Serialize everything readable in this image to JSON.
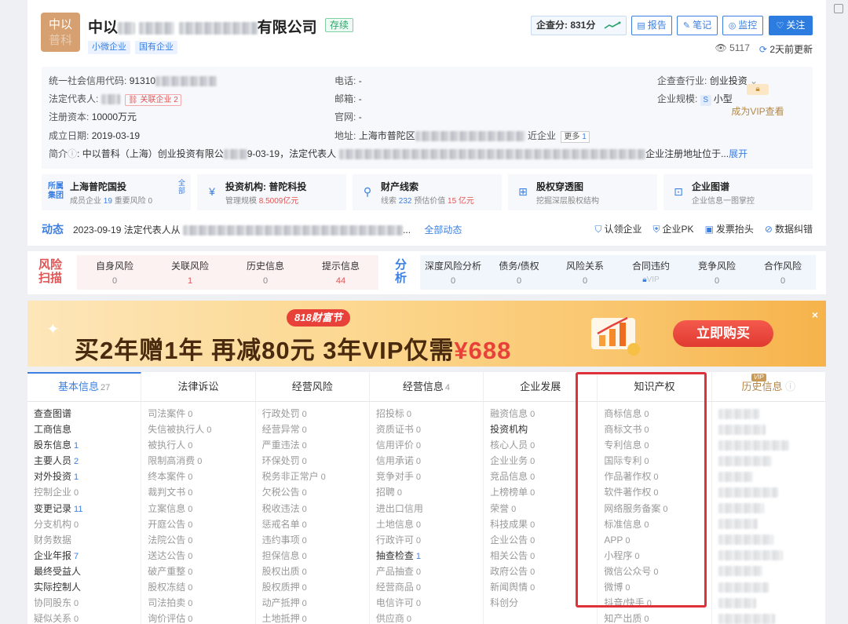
{
  "company": {
    "logo_line1": "中以",
    "logo_line2": "普科",
    "name_prefix": "中以",
    "name_suffix": "有限公司",
    "status": "存续",
    "tags": [
      "小微企业",
      "国有企业"
    ],
    "score_label": "企查分: 831分",
    "buttons": {
      "report": "报告",
      "note": "笔记",
      "monitor": "监控",
      "follow": "关注"
    },
    "views": "5117",
    "updated": "2天前更新"
  },
  "info": {
    "credit_code_label": "统一社会信用代码:",
    "credit_code_value": "91310",
    "legal_rep_label": "法定代表人:",
    "related_label": "关联企业",
    "related_count": "2",
    "capital_label": "注册资本:",
    "capital_value": "10000万元",
    "date_label": "成立日期:",
    "date_value": "2019-03-19",
    "intro_label": "简介",
    "intro_text": ": 中以普科（上海）创业投资有限公",
    "intro_mid": "9-03-19，法定代表人",
    "intro_tail": "企业注册地址位于...",
    "intro_more": "展开",
    "phone_label": "电话:",
    "phone_value": "-",
    "email_label": "邮箱:",
    "email_value": "-",
    "site_label": "官网:",
    "site_value": "-",
    "address_label": "地址:",
    "address_value": "上海市普陀区",
    "nearby": "近企业",
    "more": "更多",
    "more_count": "1",
    "industry_label": "企查查行业:",
    "industry_value": "创业投资",
    "scale_label": "企业规模:",
    "scale_badge": "S",
    "scale_value": "小型"
  },
  "quick_cards": [
    {
      "title": "上海普陀国投",
      "sub1": "成员企业",
      "v1": "19",
      "sub2": "重要风险",
      "v2": "0",
      "mark": "所属集团",
      "all": "全部"
    },
    {
      "title": "投资机构: 普陀科投",
      "sub1": "管理规模",
      "v1": "8.5009亿元"
    },
    {
      "title": "财产线索",
      "sub1": "线索",
      "v1": "232",
      "sub2": "预估价值",
      "v2": "15 亿元"
    },
    {
      "title": "股权穿透图",
      "sub1": "挖掘深层股权结构"
    },
    {
      "title": "企业图谱",
      "sub1": "企业信息一图掌控"
    }
  ],
  "dynamics": {
    "label": "动态",
    "text": "2023-09-19 法定代表人从",
    "ellipsis": "...",
    "all": "全部动态",
    "actions": [
      "认领企业",
      "企业PK",
      "发票抬头",
      "数据纠错"
    ]
  },
  "risk": {
    "mark": "风险扫描",
    "items": [
      {
        "label": "自身风险",
        "value": "0"
      },
      {
        "label": "关联风险",
        "value": "1"
      },
      {
        "label": "历史信息",
        "value": "0"
      },
      {
        "label": "提示信息",
        "value": "44"
      }
    ],
    "analysis_mark": "分析",
    "analysis": [
      {
        "label": "深度风险分析",
        "value": "0"
      },
      {
        "label": "债务/债权",
        "value": "0"
      },
      {
        "label": "风险关系",
        "value": "0"
      },
      {
        "label": "合同违约",
        "value": "VIP"
      },
      {
        "label": "竞争风险",
        "value": "0"
      },
      {
        "label": "合作风险",
        "value": "0"
      }
    ]
  },
  "banner": {
    "badge": "818财富节",
    "headline_a": "买2年赠1年 再减80元 3年VIP仅需",
    "headline_price": "¥688",
    "buy": "立即购买",
    "close": "×"
  },
  "tabs": [
    {
      "label": "基本信息",
      "count": "27"
    },
    {
      "label": "法律诉讼",
      "count": ""
    },
    {
      "label": "经营风险",
      "count": ""
    },
    {
      "label": "经营信息",
      "count": "4"
    },
    {
      "label": "企业发展",
      "count": ""
    },
    {
      "label": "知识产权",
      "count": ""
    },
    {
      "label": "历史信息",
      "count": "",
      "vip": "VIP"
    }
  ],
  "columns": [
    [
      {
        "t": "查查图谱",
        "n": ""
      },
      {
        "t": "工商信息",
        "n": ""
      },
      {
        "t": "股东信息",
        "n": "1",
        "blue": true
      },
      {
        "t": "主要人员",
        "n": "2",
        "blue": true
      },
      {
        "t": "对外投资",
        "n": "1",
        "blue": true
      },
      {
        "t": "控制企业",
        "n": "0",
        "dim": true
      },
      {
        "t": "变更记录",
        "n": "11",
        "blue": true
      },
      {
        "t": "分支机构",
        "n": "0",
        "dim": true
      },
      {
        "t": "财务数据",
        "n": "",
        "dim": true
      },
      {
        "t": "企业年报",
        "n": "7",
        "blue": true
      },
      {
        "t": "最终受益人",
        "n": ""
      },
      {
        "t": "实际控制人",
        "n": ""
      },
      {
        "t": "协同股东",
        "n": "0",
        "dim": true
      },
      {
        "t": "疑似关系",
        "n": "0",
        "dim": true
      }
    ],
    [
      {
        "t": "司法案件",
        "n": "0",
        "dim": true
      },
      {
        "t": "失信被执行人",
        "n": "0",
        "dim": true
      },
      {
        "t": "被执行人",
        "n": "0",
        "dim": true
      },
      {
        "t": "限制高消费",
        "n": "0",
        "dim": true
      },
      {
        "t": "终本案件",
        "n": "0",
        "dim": true
      },
      {
        "t": "裁判文书",
        "n": "0",
        "dim": true
      },
      {
        "t": "立案信息",
        "n": "0",
        "dim": true
      },
      {
        "t": "开庭公告",
        "n": "0",
        "dim": true
      },
      {
        "t": "法院公告",
        "n": "0",
        "dim": true
      },
      {
        "t": "送达公告",
        "n": "0",
        "dim": true
      },
      {
        "t": "破产重整",
        "n": "0",
        "dim": true
      },
      {
        "t": "股权冻结",
        "n": "0",
        "dim": true
      },
      {
        "t": "司法拍卖",
        "n": "0",
        "dim": true
      },
      {
        "t": "询价评估",
        "n": "0",
        "dim": true
      }
    ],
    [
      {
        "t": "行政处罚",
        "n": "0",
        "dim": true
      },
      {
        "t": "经营异常",
        "n": "0",
        "dim": true
      },
      {
        "t": "严重违法",
        "n": "0",
        "dim": true
      },
      {
        "t": "环保处罚",
        "n": "0",
        "dim": true
      },
      {
        "t": "税务非正常户",
        "n": "0",
        "dim": true
      },
      {
        "t": "欠税公告",
        "n": "0",
        "dim": true
      },
      {
        "t": "税收违法",
        "n": "0",
        "dim": true
      },
      {
        "t": "惩戒名单",
        "n": "0",
        "dim": true
      },
      {
        "t": "违约事项",
        "n": "0",
        "dim": true
      },
      {
        "t": "担保信息",
        "n": "0",
        "dim": true
      },
      {
        "t": "股权出质",
        "n": "0",
        "dim": true
      },
      {
        "t": "股权质押",
        "n": "0",
        "dim": true
      },
      {
        "t": "动产抵押",
        "n": "0",
        "dim": true
      },
      {
        "t": "土地抵押",
        "n": "0",
        "dim": true
      }
    ],
    [
      {
        "t": "招投标",
        "n": "0",
        "dim": true
      },
      {
        "t": "资质证书",
        "n": "0",
        "dim": true
      },
      {
        "t": "信用评价",
        "n": "0",
        "dim": true
      },
      {
        "t": "信用承诺",
        "n": "0",
        "dim": true
      },
      {
        "t": "竞争对手",
        "n": "0",
        "dim": true
      },
      {
        "t": "招聘",
        "n": "0",
        "dim": true
      },
      {
        "t": "进出口信用",
        "n": "",
        "dim": true
      },
      {
        "t": "土地信息",
        "n": "0",
        "dim": true
      },
      {
        "t": "行政许可",
        "n": "0",
        "dim": true
      },
      {
        "t": "抽查检查",
        "n": "1",
        "blue": true
      },
      {
        "t": "产品抽查",
        "n": "0",
        "dim": true
      },
      {
        "t": "经营商品",
        "n": "0",
        "dim": true
      },
      {
        "t": "电信许可",
        "n": "0",
        "dim": true
      },
      {
        "t": "供应商",
        "n": "0",
        "dim": true
      }
    ],
    [
      {
        "t": "融资信息",
        "n": "0",
        "dim": true
      },
      {
        "t": "投资机构",
        "n": ""
      },
      {
        "t": "核心人员",
        "n": "0",
        "dim": true
      },
      {
        "t": "企业业务",
        "n": "0",
        "dim": true
      },
      {
        "t": "竞品信息",
        "n": "0",
        "dim": true
      },
      {
        "t": "上榜榜单",
        "n": "0",
        "dim": true
      },
      {
        "t": "荣誉",
        "n": "0",
        "dim": true
      },
      {
        "t": "科技成果",
        "n": "0",
        "dim": true
      },
      {
        "t": "企业公告",
        "n": "0",
        "dim": true
      },
      {
        "t": "相关公告",
        "n": "0",
        "dim": true
      },
      {
        "t": "政府公告",
        "n": "0",
        "dim": true
      },
      {
        "t": "新闻舆情",
        "n": "0",
        "dim": true
      },
      {
        "t": "科创分",
        "n": "",
        "dim": true
      }
    ],
    [
      {
        "t": "商标信息",
        "n": "0",
        "dim": true
      },
      {
        "t": "商标文书",
        "n": "0",
        "dim": true
      },
      {
        "t": "专利信息",
        "n": "0",
        "dim": true
      },
      {
        "t": "国际专利",
        "n": "0",
        "dim": true
      },
      {
        "t": "作品著作权",
        "n": "0",
        "dim": true
      },
      {
        "t": "软件著作权",
        "n": "0",
        "dim": true
      },
      {
        "t": "网络服务备案",
        "n": "0",
        "dim": true
      },
      {
        "t": "标准信息",
        "n": "0",
        "dim": true
      },
      {
        "t": "APP",
        "n": "0",
        "dim": true
      },
      {
        "t": "小程序",
        "n": "0",
        "dim": true
      },
      {
        "t": "微信公众号",
        "n": "0",
        "dim": true
      },
      {
        "t": "微博",
        "n": "0",
        "dim": true
      },
      {
        "t": "抖音/快手",
        "n": "0",
        "dim": true
      },
      {
        "t": "知产出质",
        "n": "0",
        "dim": true
      }
    ]
  ],
  "vip_cover": "成为VIP查看"
}
